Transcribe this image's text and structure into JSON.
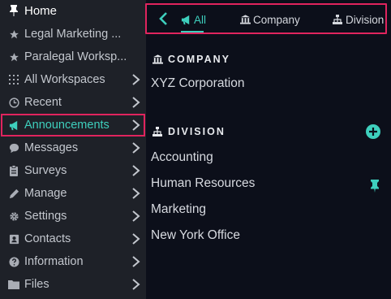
{
  "sidebar": {
    "items": [
      {
        "label": "Home",
        "icon": "pin-icon"
      },
      {
        "label": "Legal Marketing ...",
        "icon": "star-icon"
      },
      {
        "label": "Paralegal Worksp...",
        "icon": "star-icon"
      },
      {
        "label": "All Workspaces",
        "icon": "grid-icon"
      },
      {
        "label": "Recent",
        "icon": "clock-icon"
      },
      {
        "label": "Announcements",
        "icon": "megaphone-icon"
      },
      {
        "label": "Messages",
        "icon": "chat-bubble-icon"
      },
      {
        "label": "Surveys",
        "icon": "clipboard-icon"
      },
      {
        "label": "Manage",
        "icon": "pencil-icon"
      },
      {
        "label": "Settings",
        "icon": "gear-icon"
      },
      {
        "label": "Contacts",
        "icon": "contact-card-icon"
      },
      {
        "label": "Information",
        "icon": "question-icon"
      },
      {
        "label": "Files",
        "icon": "folder-icon"
      }
    ]
  },
  "tabs": [
    {
      "label": "All",
      "icon": "megaphone-icon"
    },
    {
      "label": "Company",
      "icon": "company-icon"
    },
    {
      "label": "Division",
      "icon": "division-icon"
    }
  ],
  "company": {
    "header": "COMPANY",
    "items": [
      "XYZ Corporation"
    ]
  },
  "division": {
    "header": "DIVISION",
    "items": [
      "Accounting",
      "Human Resources",
      "Marketing",
      "New York Office"
    ]
  },
  "colors": {
    "accent": "#3ecfbd",
    "highlight": "#e0245e",
    "sidebar_bg": "#1e2128",
    "main_bg": "#0c0f1a"
  }
}
